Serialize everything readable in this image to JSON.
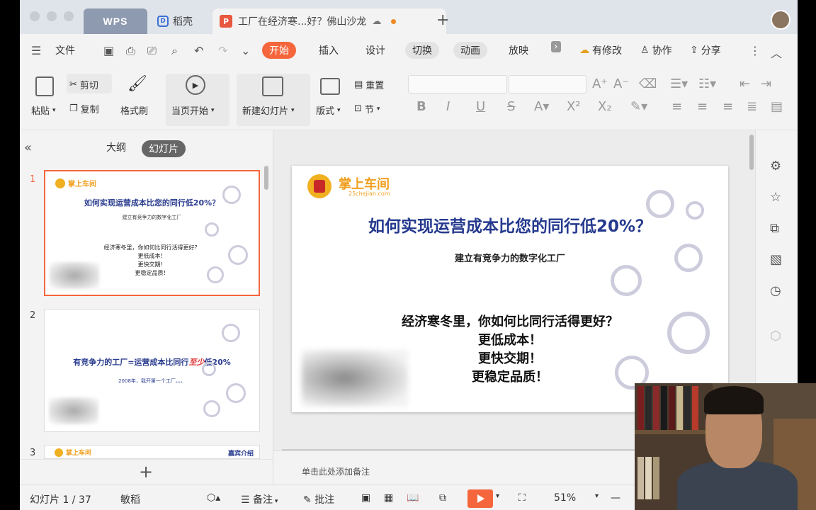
{
  "window": {
    "tabs": [
      {
        "label": "WPS"
      },
      {
        "label": "稻壳"
      },
      {
        "label": "工厂在经济寒...好？佛山沙龙"
      }
    ]
  },
  "menu": {
    "file": "文件",
    "tabs": [
      "开始",
      "插入",
      "设计",
      "切换",
      "动画",
      "放映"
    ],
    "active_tab": "开始",
    "right": [
      "有修改",
      "协作",
      "分享"
    ]
  },
  "ribbon": {
    "paste": "粘贴",
    "cut": "剪切",
    "copy": "复制",
    "format_painter": "格式刷",
    "from_current": "当页开始",
    "new_slide": "新建幻灯片",
    "layout": "版式",
    "reset": "重置",
    "section": "节"
  },
  "left_panel": {
    "outline_tab": "大纲",
    "slides_tab": "幻灯片",
    "thumbs": [
      {
        "num": "1",
        "brand": "掌上车间",
        "title": "如何实现运营成本比您的同行低20%？",
        "sub": "建立有竞争力的数字化工厂",
        "body": [
          "经济寒冬里，你如何比同行活得更好？",
          "更低成本！",
          "更快交期！",
          "更稳定品质！"
        ]
      },
      {
        "num": "2",
        "title_a": "有竞争力的工厂=运营成本比同行",
        "title_b": "至少",
        "title_c": "低20%",
        "sub": "2008年，我开第一个工厂。。。"
      },
      {
        "num": "3",
        "brand": "掌上车间",
        "right": "嘉宾介绍"
      }
    ]
  },
  "slide": {
    "brand": "掌上车间",
    "brand_sub": "25chejian.com",
    "title": "如何实现运营成本比您的同行低20%？",
    "subtitle": "建立有竞争力的数字化工厂",
    "lines": [
      "经济寒冬里，你如何比同行活得更好？",
      "更低成本！",
      "更快交期！",
      "更稳定品质！"
    ]
  },
  "notes_placeholder": "单击此处添加备注",
  "status": {
    "slide_counter": "幻灯片 1 / 37",
    "mode": "敏稻",
    "notes": "备注",
    "comments": "批注",
    "zoom": "51%"
  },
  "colors": {
    "accent": "#f5663c",
    "title_blue": "#253a8e",
    "brand_gold": "#f0a020"
  }
}
